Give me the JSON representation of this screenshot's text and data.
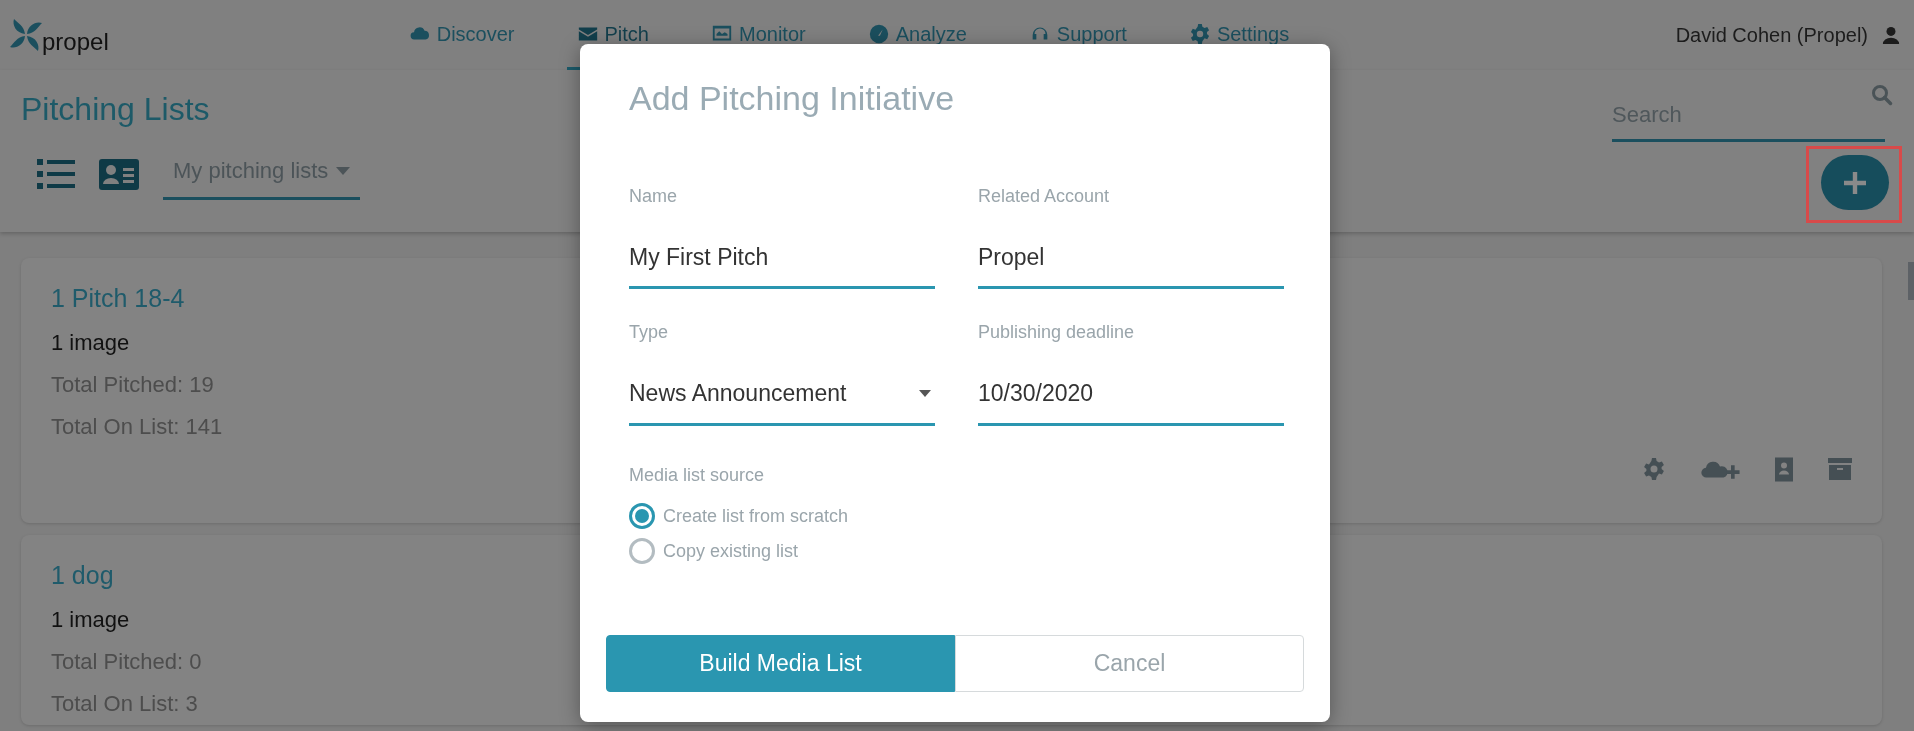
{
  "logo": {
    "text": "propel"
  },
  "nav": [
    {
      "label": "Discover",
      "selected": false
    },
    {
      "label": "Pitch",
      "selected": true
    },
    {
      "label": "Monitor",
      "selected": false
    },
    {
      "label": "Analyze",
      "selected": false
    },
    {
      "label": "Support",
      "selected": false
    },
    {
      "label": "Settings",
      "selected": false
    }
  ],
  "user": {
    "name": "David Cohen (Propel)"
  },
  "page": {
    "title": "Pitching Lists",
    "filter": "My pitching lists",
    "search": {
      "placeholder": "Search"
    },
    "add_button": {
      "highlighted": true
    }
  },
  "lists": [
    {
      "title": "1 Pitch 18-4",
      "images": "1 image",
      "total_pitched": "Total Pitched: 19",
      "total_on_list": "Total On List: 141"
    },
    {
      "title": "1 dog",
      "images": "1 image",
      "total_pitched": "Total Pitched: 0",
      "total_on_list": "Total On List: 3"
    }
  ],
  "dialog": {
    "title": "Add Pitching Initiative",
    "fields": [
      {
        "kind": "text",
        "label": "Name",
        "value": "My First Pitch"
      },
      {
        "kind": "text",
        "label": "Related Account",
        "value": "Propel"
      },
      {
        "kind": "select",
        "label": "Type",
        "value": "News Announcement"
      },
      {
        "kind": "text",
        "label": "Publishing deadline",
        "value": "10/30/2020"
      }
    ],
    "source": {
      "label": "Media list source",
      "options": [
        {
          "label": "Create list from scratch",
          "selected": true
        },
        {
          "label": "Copy existing list",
          "selected": false
        }
      ]
    },
    "buttons": [
      {
        "kind": "primary",
        "label": "Build Media List"
      },
      {
        "kind": "secondary",
        "label": "Cancel"
      }
    ]
  }
}
